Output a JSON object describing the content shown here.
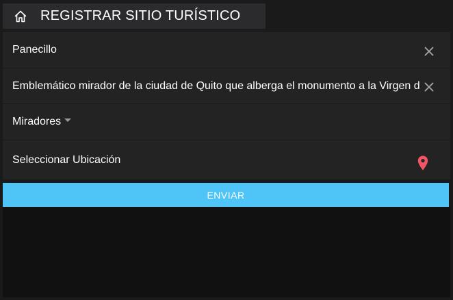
{
  "header": {
    "icon": "home-icon",
    "title": "REGISTRAR SITIO TURÍSTICO"
  },
  "form": {
    "name_value": "Panecillo",
    "description_value": "Emblemático mirador de la ciudad de Quito que alberga el monumento a la Virgen de",
    "category_value": "Miradores",
    "location_label": "Seleccionar Ubicación",
    "pin_color": "#f25465"
  },
  "submit_label": "ENVIAR",
  "colors": {
    "background": "#1a1a1a",
    "header": "#2b2b2d",
    "form": "#232323",
    "accent": "#4fc4f6"
  }
}
